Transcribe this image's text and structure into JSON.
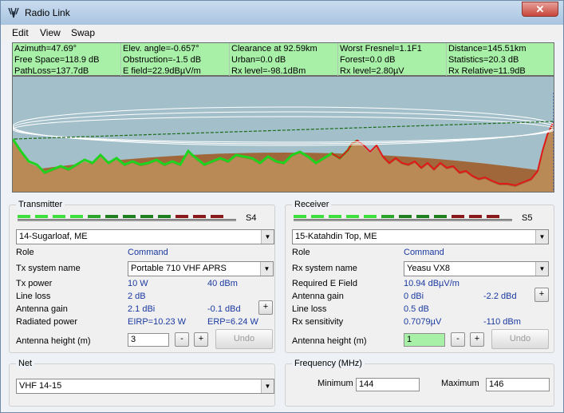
{
  "window": {
    "title": "Radio Link",
    "close_label": "✕"
  },
  "menu": [
    "Edit",
    "View",
    "Swap"
  ],
  "info_rows": [
    [
      "Azimuth=47.69°",
      "Elev. angle=-0.657°",
      "Clearance at 92.59km",
      "Worst Fresnel=1.1F1",
      "Distance=145.51km"
    ],
    [
      "Free Space=118.9 dB",
      "Obstruction=-1.5 dB",
      "Urban=0.0 dB",
      "Forest=0.0 dB",
      "Statistics=20.3 dB"
    ],
    [
      "PathLoss=137.7dB",
      "E field=22.9dBµV/m",
      "Rx level=-98.1dBm",
      "Rx level=2.80µV",
      "Rx Relative=11.9dB"
    ]
  ],
  "colors": {
    "info_bg": "#a8f0a8",
    "sky": "#a3bfca",
    "terrain": "#b57a45",
    "value_text": "#1a39a0"
  },
  "transmitter": {
    "title": "Transmitter",
    "s_meter": "S4",
    "site": "14-Sugarloaf, ME",
    "role_label": "Role",
    "role_value": "Command",
    "system_label": "Tx system name",
    "system_value": "Portable 710 VHF APRS",
    "power_label": "Tx power",
    "power_w": "10 W",
    "power_dbm": "40 dBm",
    "line_loss_label": "Line loss",
    "line_loss_value": "2 dB",
    "gain_label": "Antenna gain",
    "gain_dbi": "2.1 dBi",
    "gain_dbd": "-0.1 dBd",
    "radiated_label": "Radiated power",
    "eirp": "EIRP=10.23 W",
    "erp": "ERP=6.24 W",
    "height_label": "Antenna height (m)",
    "height_value": "3",
    "minus": "-",
    "plus": "+",
    "undo": "Undo"
  },
  "receiver": {
    "title": "Receiver",
    "s_meter": "S5",
    "site": "15-Katahdin Top, ME",
    "role_label": "Role",
    "role_value": "Command",
    "system_label": "Rx system name",
    "system_value": "Yeasu VX8",
    "req_label": "Required E Field",
    "req_value": "10.94 dBµV/m",
    "gain_label": "Antenna gain",
    "gain_dbi": "0 dBi",
    "gain_dbd": "-2.2 dBd",
    "line_loss_label": "Line loss",
    "line_loss_value": "0.5 dB",
    "sens_label": "Rx sensitivity",
    "sens_uv": "0.7079µV",
    "sens_dbm": "-110 dBm",
    "height_label": "Antenna height (m)",
    "height_value": "1",
    "minus": "-",
    "plus": "+",
    "undo": "Undo"
  },
  "net": {
    "title": "Net",
    "value": "VHF 14-15"
  },
  "frequency": {
    "title": "Frequency (MHz)",
    "min_label": "Minimum",
    "min_value": "144",
    "max_label": "Maximum",
    "max_value": "146"
  }
}
